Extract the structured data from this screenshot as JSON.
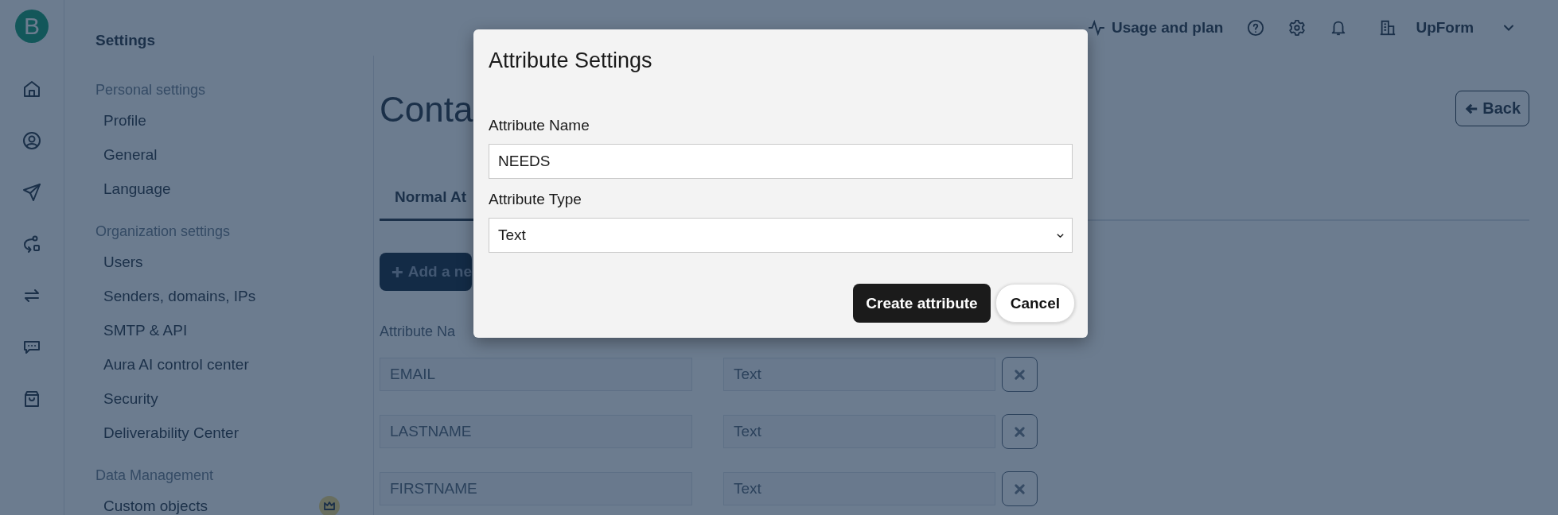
{
  "rail": {
    "logo": "B"
  },
  "sidebar": {
    "title": "Settings",
    "sections": [
      {
        "heading": "Personal settings",
        "items": [
          {
            "label": "Profile",
            "premium": false
          },
          {
            "label": "General",
            "premium": false
          },
          {
            "label": "Language",
            "premium": false
          }
        ]
      },
      {
        "heading": "Organization settings",
        "items": [
          {
            "label": "Users",
            "premium": false
          },
          {
            "label": "Senders, domains, IPs",
            "premium": false
          },
          {
            "label": "SMTP & API",
            "premium": false
          },
          {
            "label": "Aura AI control center",
            "premium": false
          },
          {
            "label": "Security",
            "premium": false
          },
          {
            "label": "Deliverability Center",
            "premium": false
          }
        ]
      },
      {
        "heading": "Data Management",
        "items": [
          {
            "label": "Custom objects",
            "premium": true
          }
        ]
      }
    ]
  },
  "top_bar": {
    "usage": "Usage and plan",
    "organization": "UpForm"
  },
  "page": {
    "heading": "Conta",
    "back_button": "Back",
    "tabs": [
      {
        "label": "Normal At",
        "selected": true
      }
    ],
    "add_button": "Add a ne",
    "column_header": "Attribute Na",
    "rows": [
      {
        "name": "EMAIL",
        "type": "Text"
      },
      {
        "name": "LASTNAME",
        "type": "Text"
      },
      {
        "name": "FIRSTNAME",
        "type": "Text"
      }
    ]
  },
  "modal": {
    "title": "Attribute Settings",
    "name_label": "Attribute Name",
    "name_value": "NEEDS",
    "type_label": "Attribute Type",
    "type_value": "Text",
    "create_button": "Create attribute",
    "cancel_button": "Cancel"
  }
}
